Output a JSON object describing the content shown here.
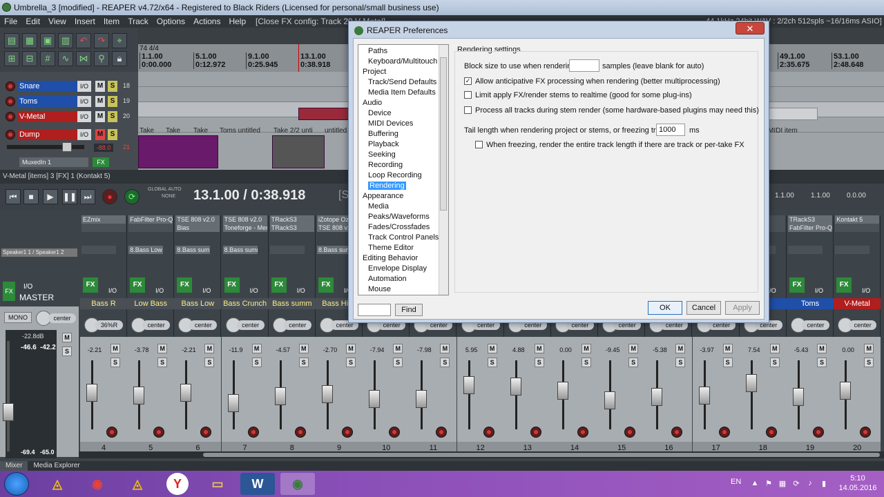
{
  "window": {
    "title": "Umbrella_3 [modified] - REAPER v4.72/x64 - Registered to Black Riders (Licensed for personal/small business use)",
    "status": "[Close FX config: Track 20 V-Metal]",
    "audio_status": "44.1kHz 24bit WAV : 2/2ch 512spls ~16/16ms ASIO]"
  },
  "menu": [
    "File",
    "Edit",
    "View",
    "Insert",
    "Item",
    "Track",
    "Options",
    "Actions",
    "Help"
  ],
  "timeline": {
    "time_signature": "74 4/4",
    "markers": [
      {
        "bar": "1.1.00",
        "time": "0:00.000"
      },
      {
        "bar": "5.1.00",
        "time": "0:12.972"
      },
      {
        "bar": "9.1.00",
        "time": "0:25.945"
      },
      {
        "bar": "13.1.00",
        "time": "0:38.918"
      },
      {
        "bar": "49.1.00",
        "time": "2:35.675"
      },
      {
        "bar": "53.1.00",
        "time": "2:48.648"
      }
    ]
  },
  "tracks": [
    {
      "name": "Snare",
      "io": "I/O",
      "m": "M",
      "s": "S",
      "num": "18",
      "color": "#1f4fa8"
    },
    {
      "name": "Toms",
      "io": "I/O",
      "m": "M",
      "s": "S",
      "num": "19",
      "color": "#1f4fa8"
    },
    {
      "name": "V-Metal",
      "io": "I/O",
      "m": "M",
      "s": "S",
      "num": "20",
      "color": "#b01e1e"
    },
    {
      "name": "Dump",
      "io": "I/O",
      "m": "M",
      "s": "S",
      "num": "21",
      "color": "#b01e1e"
    }
  ],
  "track_extra": {
    "volume": "-88.0",
    "muxed": "MuxedIn 1",
    "fx": "FX"
  },
  "item_labels": [
    "Take",
    "Take",
    "Take",
    "Toms untitled",
    "Take 2/2 unti",
    "untitled",
    "MIDI item"
  ],
  "statusline": "V-Metal [items] 3 [FX] 1 (Kontakt 5)",
  "transport": {
    "time": "13.1.00 / 0:38.918",
    "global_auto": "GLOBAL AUTO",
    "none": "NONE",
    "s_label": "[S",
    "rate1": "1.1.00",
    "rate2": "1.1.00",
    "rate3": "0.0.00",
    "buttons": [
      "⏮",
      "■",
      "▶",
      "❚❚",
      "⏭"
    ]
  },
  "master": {
    "label": "MASTER",
    "mono": "MONO",
    "pan": "center",
    "peak_db": "-22.8dB",
    "peak_l": "-46.6",
    "peak_r": "-42.2",
    "rms_l": "-69.4",
    "rms_r": "-65.0",
    "speaker": "Speaker1 1 / Speaker1 2",
    "fx": "FX",
    "io": "I/O",
    "scale": [
      "6",
      "12",
      "18",
      "24",
      "30",
      "36",
      "42",
      "54"
    ]
  },
  "strips": [
    {
      "fx1": "EZmix",
      "fx2": "",
      "send": "",
      "name": "Bass R",
      "pan": "36%R",
      "vol": "-2.21",
      "num": "4"
    },
    {
      "fx1": "FabFilter Pro-Q",
      "fx2": "",
      "send": "8.Bass Low",
      "name": "Low Bass",
      "pan": "center",
      "vol": "-3.78",
      "num": "5"
    },
    {
      "fx1": "TSE 808 v2.0",
      "fx2": "Bias",
      "send": "8.Bass summ",
      "name": "Bass Low",
      "pan": "center",
      "vol": "-2.21",
      "num": "6"
    },
    {
      "fx1": "TSE 808 v2.0",
      "fx2": "Toneforge - Men",
      "send": "8.Bass summ",
      "name": "Bass Crunch",
      "pan": "center",
      "vol": "-11.9",
      "num": "7"
    },
    {
      "fx1": "TRackS3",
      "fx2": "TRackS3",
      "send": "",
      "name": "Bass summ",
      "pan": "center",
      "vol": "-4.57",
      "num": "8"
    },
    {
      "fx1": "iZotope Oz",
      "fx2": "TSE 808 v2",
      "send": "8.Bass summ",
      "name": "Bass Hi G",
      "pan": "center",
      "vol": "-2.70",
      "num": "9"
    },
    {
      "fx1": "",
      "fx2": "",
      "send": "",
      "name": "",
      "pan": "center",
      "vol": "-7.94",
      "num": "10"
    },
    {
      "fx1": "",
      "fx2": "",
      "send": "",
      "name": "",
      "pan": "center",
      "vol": "-7.98",
      "num": "11"
    },
    {
      "fx1": "",
      "fx2": "",
      "send": "",
      "name": "",
      "pan": "center",
      "vol": "5.95",
      "num": "12"
    },
    {
      "fx1": "",
      "fx2": "",
      "send": "",
      "name": "",
      "pan": "center",
      "vol": "4.88",
      "num": "13"
    },
    {
      "fx1": "",
      "fx2": "",
      "send": "",
      "name": "",
      "pan": "center",
      "vol": "0.00",
      "num": "14"
    },
    {
      "fx1": "",
      "fx2": "",
      "send": "",
      "name": "",
      "pan": "center",
      "vol": "-9.45",
      "num": "15"
    },
    {
      "fx1": "",
      "fx2": "",
      "send": "",
      "name": "",
      "pan": "center",
      "vol": "-5.38",
      "num": "16"
    },
    {
      "fx1": "",
      "fx2": "",
      "send": "",
      "name": "",
      "pan": "center",
      "vol": "-3.97",
      "num": "17"
    },
    {
      "fx1": "",
      "fx2": "",
      "send": "",
      "name": "re",
      "pan": "center",
      "vol": "7.54",
      "num": "18"
    },
    {
      "fx1": "TRackS3",
      "fx2": "FabFilter Pro-Q",
      "send": "",
      "name": "Toms",
      "pan": "center",
      "vol": "-5.43",
      "num": "19"
    },
    {
      "fx1": "Kontakt 5",
      "fx2": "",
      "send": "",
      "name": "V-Metal",
      "pan": "center",
      "vol": "0.00",
      "num": "20"
    }
  ],
  "strip_labels": {
    "fx": "FX",
    "io": "I/O",
    "m": "M",
    "s": "S"
  },
  "mixer_tabs": [
    "Mixer",
    "Media Explorer"
  ],
  "dialog": {
    "title": "REAPER Preferences",
    "close": "✕",
    "tree": [
      {
        "label": "Paths",
        "indent": 1
      },
      {
        "label": "Keyboard/Multitouch",
        "indent": 1
      },
      {
        "label": "Project",
        "indent": 0
      },
      {
        "label": "Track/Send Defaults",
        "indent": 1
      },
      {
        "label": "Media Item Defaults",
        "indent": 1
      },
      {
        "label": "Audio",
        "indent": 0
      },
      {
        "label": "Device",
        "indent": 1
      },
      {
        "label": "MIDI Devices",
        "indent": 1
      },
      {
        "label": "Buffering",
        "indent": 1
      },
      {
        "label": "Playback",
        "indent": 1
      },
      {
        "label": "Seeking",
        "indent": 1
      },
      {
        "label": "Recording",
        "indent": 1
      },
      {
        "label": "Loop Recording",
        "indent": 1
      },
      {
        "label": "Rendering",
        "indent": 1,
        "selected": true
      },
      {
        "label": "Appearance",
        "indent": 0
      },
      {
        "label": "Media",
        "indent": 1
      },
      {
        "label": "Peaks/Waveforms",
        "indent": 1
      },
      {
        "label": "Fades/Crossfades",
        "indent": 1
      },
      {
        "label": "Track Control Panels",
        "indent": 1
      },
      {
        "label": "Theme Editor",
        "indent": 1
      },
      {
        "label": "Editing Behavior",
        "indent": 0
      },
      {
        "label": "Envelope Display",
        "indent": 1
      },
      {
        "label": "Automation",
        "indent": 1
      },
      {
        "label": "Mouse",
        "indent": 1
      }
    ],
    "find_value": "",
    "find_button": "Find",
    "section": "Rendering settings",
    "block_size_label": "Block size to use when rendering:",
    "block_size_value": "",
    "block_size_suffix": "samples (leave blank for auto)",
    "options": [
      {
        "label": "Allow anticipative FX processing when rendering (better multiprocessing)",
        "checked": true
      },
      {
        "label": "Limit apply FX/render stems to realtime (good for some plug-ins)",
        "checked": false
      },
      {
        "label": "Process all tracks during stem render (some hardware-based plugins may need this)",
        "checked": false
      }
    ],
    "tail_label": "Tail length when rendering project or stems, or freezing tracks:",
    "tail_value": "1000",
    "tail_unit": "ms",
    "freeze_label": "When freezing, render the entire track length if there are track or per-take FX",
    "freeze_checked": false,
    "ok": "OK",
    "cancel": "Cancel",
    "apply": "Apply"
  },
  "taskbar": {
    "lang": "EN",
    "time": "5:10",
    "date": "14.05.2016"
  }
}
